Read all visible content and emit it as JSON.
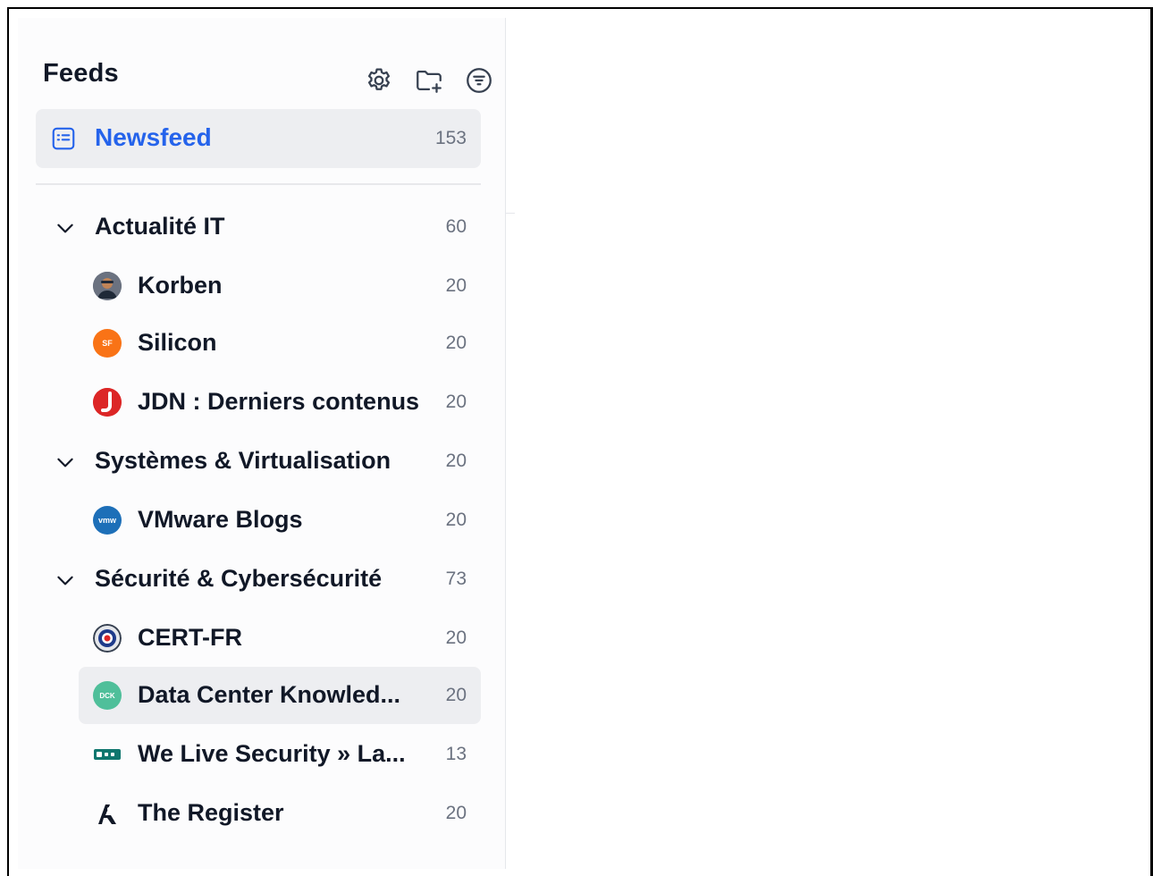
{
  "header": {
    "title": "Feeds",
    "actions": [
      {
        "icon": "gear-icon",
        "name": "settings-button"
      },
      {
        "icon": "folder-add-icon",
        "name": "add-folder-button"
      },
      {
        "icon": "filter-icon",
        "name": "filter-button"
      }
    ]
  },
  "newsfeed": {
    "label": "Newsfeed",
    "count": "153",
    "icon": "list-icon",
    "color": "#2563eb"
  },
  "categories": [
    {
      "label": "Actualité IT",
      "count": "60",
      "feeds": [
        {
          "label": "Korben",
          "count": "20",
          "icon": "korben-avatar-icon"
        },
        {
          "label": "Silicon",
          "count": "20",
          "icon": "silicon-logo-icon"
        },
        {
          "label": "JDN : Derniers contenus",
          "count": "20",
          "icon": "jdn-logo-icon"
        }
      ]
    },
    {
      "label": "Systèmes & Virtualisation",
      "count": "20",
      "feeds": [
        {
          "label": "VMware Blogs",
          "count": "20",
          "icon": "vmware-logo-icon"
        }
      ]
    },
    {
      "label": "Sécurité & Cybersécurité",
      "count": "73",
      "feeds": [
        {
          "label": "CERT-FR",
          "count": "20",
          "icon": "cert-fr-logo-icon"
        },
        {
          "label": "Data Center Knowled...",
          "count": "20",
          "icon": "dck-logo-icon",
          "selected": true
        },
        {
          "label": "We Live Security » La...",
          "count": "13",
          "icon": "welivesecurity-logo-icon"
        },
        {
          "label": "The Register",
          "count": "20",
          "icon": "the-register-logo-icon"
        }
      ]
    }
  ],
  "favicon_text": {
    "silicon": "SF",
    "vmware": "vmw",
    "dck": "DCK"
  }
}
